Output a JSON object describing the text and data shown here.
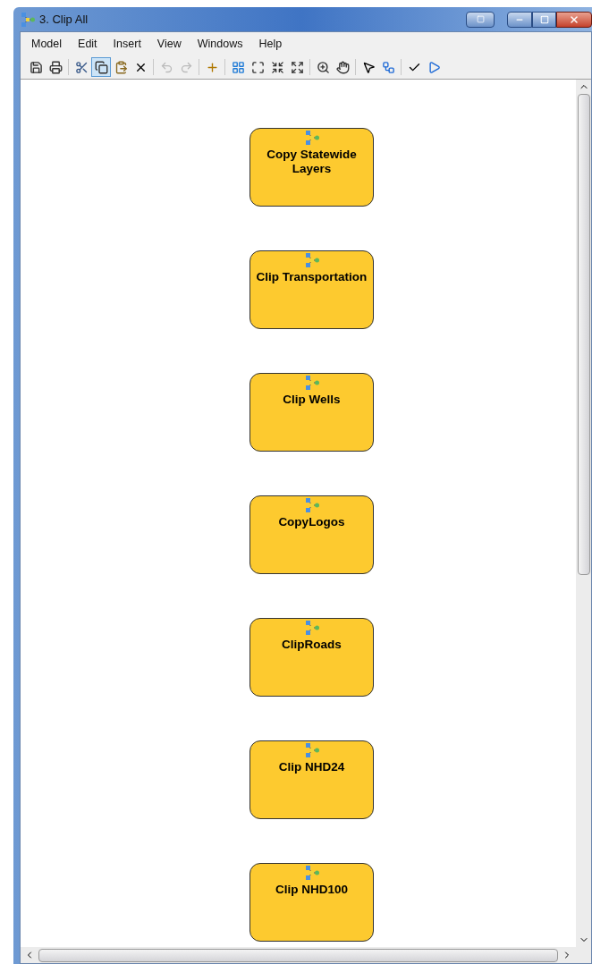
{
  "window": {
    "title": "3. Clip All"
  },
  "menu": [
    "Model",
    "Edit",
    "Insert",
    "View",
    "Windows",
    "Help"
  ],
  "toolbar": [
    [
      {
        "kind": "save",
        "selected": false,
        "disabled": false
      },
      {
        "kind": "print",
        "selected": false,
        "disabled": false
      }
    ],
    [
      {
        "kind": "cut",
        "selected": false,
        "disabled": false
      },
      {
        "kind": "copy",
        "selected": true,
        "disabled": false
      },
      {
        "kind": "paste",
        "selected": false,
        "disabled": false
      },
      {
        "kind": "delete",
        "selected": false,
        "disabled": false
      }
    ],
    [
      {
        "kind": "undo",
        "selected": false,
        "disabled": true
      },
      {
        "kind": "redo",
        "selected": false,
        "disabled": true
      }
    ],
    [
      {
        "kind": "add",
        "selected": false,
        "disabled": false
      }
    ],
    [
      {
        "kind": "layout",
        "selected": false,
        "disabled": false
      },
      {
        "kind": "extent",
        "selected": false,
        "disabled": false
      },
      {
        "kind": "shrink",
        "selected": false,
        "disabled": false
      },
      {
        "kind": "expand",
        "selected": false,
        "disabled": false
      }
    ],
    [
      {
        "kind": "zoom",
        "selected": false,
        "disabled": false
      },
      {
        "kind": "pan",
        "selected": false,
        "disabled": false
      }
    ],
    [
      {
        "kind": "select",
        "selected": false,
        "disabled": false
      },
      {
        "kind": "connect",
        "selected": false,
        "disabled": false
      }
    ],
    [
      {
        "kind": "validate",
        "selected": false,
        "disabled": false
      },
      {
        "kind": "run",
        "selected": false,
        "disabled": false
      }
    ]
  ],
  "nodes": [
    {
      "label": "Copy Statewide Layers"
    },
    {
      "label": "Clip Transportation"
    },
    {
      "label": "Clip Wells"
    },
    {
      "label": "CopyLogos"
    },
    {
      "label": "ClipRoads"
    },
    {
      "label": "Clip NHD24"
    },
    {
      "label": "Clip NHD100"
    }
  ]
}
